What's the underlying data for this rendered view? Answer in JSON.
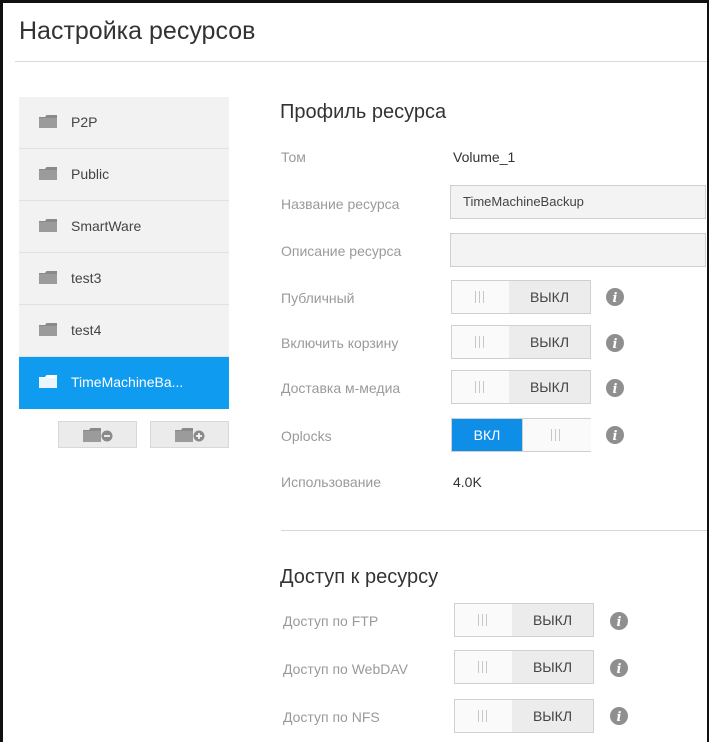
{
  "page": {
    "title": "Настройка ресурсов"
  },
  "sidebar": {
    "items": [
      {
        "label": "P2P",
        "selected": false
      },
      {
        "label": "Public",
        "selected": false
      },
      {
        "label": "SmartWare",
        "selected": false
      },
      {
        "label": "test3",
        "selected": false
      },
      {
        "label": "test4",
        "selected": false
      },
      {
        "label": "TimeMachineBa...",
        "selected": true
      }
    ],
    "remove_button_icon": "folder-minus-icon",
    "add_button_icon": "folder-plus-icon"
  },
  "profile": {
    "title": "Профиль ресурса",
    "volume_label": "Том",
    "volume_value": "Volume_1",
    "share_name_label": "Название ресурса",
    "share_name_value": "TimeMachineBackup",
    "description_label": "Описание ресурса",
    "description_value": "",
    "public_label": "Публичный",
    "public_state": "ВЫКЛ",
    "recycle_label": "Включить корзину",
    "recycle_state": "ВЫКЛ",
    "media_label": "Доставка м-медиа",
    "media_state": "ВЫКЛ",
    "oplocks_label": "Oplocks",
    "oplocks_state": "ВКЛ",
    "usage_label": "Использование",
    "usage_value": "4.0K"
  },
  "access": {
    "title": "Доступ к ресурсу",
    "ftp_label": "Доступ по FTP",
    "ftp_state": "ВЫКЛ",
    "webdav_label": "Доступ по WebDAV",
    "webdav_state": "ВЫКЛ",
    "nfs_label": "Доступ по NFS",
    "nfs_state": "ВЫКЛ"
  },
  "colors": {
    "accent": "#0f9bf0",
    "toggle_on": "#0f8ee8",
    "label": "#9a9a9a"
  }
}
